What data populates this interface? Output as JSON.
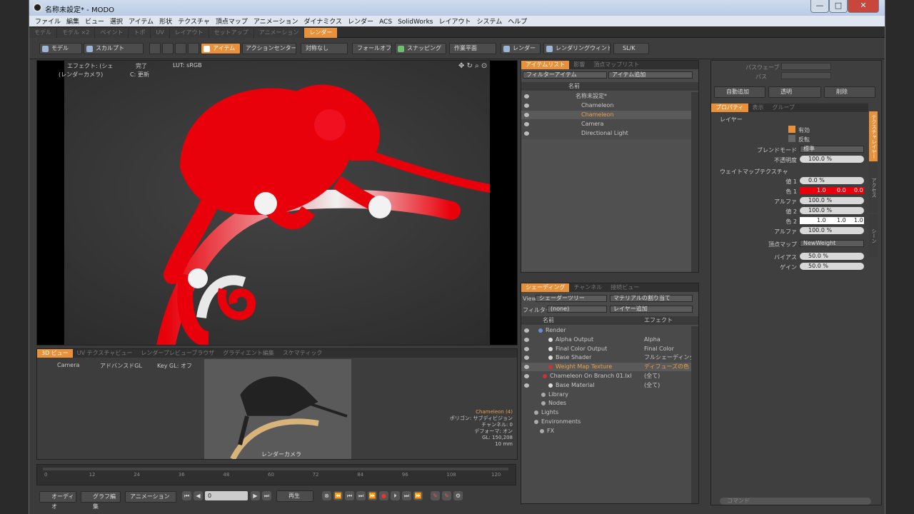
{
  "window": {
    "title": "名称未設定* - MODO"
  },
  "menu": [
    "ファイル",
    "編集",
    "ビュー",
    "選択",
    "アイテム",
    "形状",
    "テクスチャ",
    "頂点マップ",
    "アニメーション",
    "ダイナミクス",
    "レンダー",
    "ACS",
    "SolidWorks",
    "レイアウト",
    "システム",
    "ヘルプ"
  ],
  "layout_tabs": [
    "モデル",
    "モデル ×2",
    "ペイント",
    "トポ",
    "UV",
    "レイアウト",
    "セットアップ",
    "アニメーション",
    "レンダー"
  ],
  "toolbar": {
    "model": "モデル",
    "sculpt": "スカルプト",
    "item": "アイテム",
    "action_center": "アクションセンター ▾",
    "falloff": "フォールオフ",
    "snapping": "スナッピング",
    "work_plane": "作業平面",
    "render": "レンダー",
    "render_window": "レンダリングウィンドウ",
    "symmetry": "対称なし",
    "sl": "SL/K"
  },
  "viewport": {
    "effect": "エフェクト: (シェ",
    "complete": "完了",
    "lut": "LUT: sRGB",
    "render_camera": "(レンダーカメラ)",
    "update": "C: 更新"
  },
  "items_panel": {
    "tabs": [
      "アイテムリスト",
      "影響",
      "頂点マップリスト"
    ],
    "filter": "フィルターアイテム",
    "add": "アイテム追加",
    "col_name": "名前",
    "rows": [
      "名称未設定*",
      "Chameleon",
      "Chameleon",
      "Camera",
      "Directional Light"
    ]
  },
  "shader_panel": {
    "tabs": [
      "シェーディング",
      "チャンネル",
      "接続ビュー"
    ],
    "view_label": "View",
    "view_value": "シェーダーツリー",
    "material_btn": "マテリアルの割り当て",
    "filter_label": "フィルター",
    "filter_value": "(none)",
    "layer_add": "レイヤー追加",
    "col_name": "名前",
    "col_effect": "エフェクト",
    "rows": [
      {
        "name": "Render",
        "effect": ""
      },
      {
        "name": "Alpha Output",
        "effect": "Alpha"
      },
      {
        "name": "Final Color Output",
        "effect": "Final Color"
      },
      {
        "name": "Base Shader",
        "effect": "フルシェーディング"
      },
      {
        "name": "Weight Map Texture",
        "effect": "ディフューズの色"
      },
      {
        "name": "Chameleon On Branch 01.lxl",
        "effect": "(全て)"
      },
      {
        "name": "Base Material",
        "effect": "(全て)"
      },
      {
        "name": "Library",
        "effect": ""
      },
      {
        "name": "Nodes",
        "effect": ""
      },
      {
        "name": "Lights",
        "effect": ""
      },
      {
        "name": "Environments",
        "effect": ""
      },
      {
        "name": "FX",
        "effect": ""
      }
    ]
  },
  "properties": {
    "top": {
      "pathwave": "パスウェーブ",
      "paths": "パス",
      "autoadd": "自動追加",
      "transparent": "透明",
      "delete": "削除"
    },
    "tabs": [
      "プロパティ",
      "表示",
      "グループ"
    ],
    "section_layer": "レイヤー",
    "enable": "有効",
    "invert": "反転",
    "blend_mode_label": "ブレンドモード",
    "blend_mode": "標準",
    "opacity_label": "不透明度",
    "opacity": "100.0 %",
    "section_weight": "ウェイトマップテクスチャ",
    "value1_label": "値 1",
    "value1": "0.0 %",
    "color1_label": "色 1",
    "color1": [
      "1.0",
      "0.0",
      "0.0"
    ],
    "alpha1_label": "アルファ",
    "alpha1": "100.0 %",
    "value2_label": "値 2",
    "value2": "100.0 %",
    "color2_label": "色 2",
    "color2": [
      "1.0",
      "1.0",
      "1.0"
    ],
    "alpha2_label": "アルファ",
    "alpha2": "100.0 %",
    "vmap_label": "頂点マップ",
    "vmap": "NewWeight",
    "bias_label": "バイアス",
    "bias": "50.0 %",
    "gain_label": "ゲイン",
    "gain": "50.0 %",
    "vtabs": [
      "テクスチャレイヤー",
      "アクセス",
      "シーン"
    ],
    "command": "コマンド"
  },
  "lower_tabs": [
    "3D ビュー",
    "UV テクスチャビュー",
    "レンダープレビューブラウザ",
    "グラディエント編集",
    "スケマティック"
  ],
  "lower_view": {
    "camera": "Camera",
    "advanced": "アドバンスドGL",
    "key": "Key GL: オフ",
    "cam_label": "レンダーカメラ",
    "info": [
      "Chameleon (4)",
      "ポリゴン: サブディビジョン",
      "チャンネル: 0",
      "デフォーマ: オン",
      "GL: 150,208",
      "10 mm"
    ]
  },
  "timeline": {
    "ticks": [
      "0",
      "12",
      "24",
      "36",
      "48",
      "60",
      "72",
      "84",
      "96",
      "108",
      "120"
    ]
  },
  "bottom": {
    "audio": "オーディオ",
    "graph": "グラフ編集",
    "anim": "アニメーション",
    "play": "再生",
    "frame": "0"
  },
  "colors": {
    "accent": "#e8913a",
    "chameleon": "#e8000a"
  }
}
